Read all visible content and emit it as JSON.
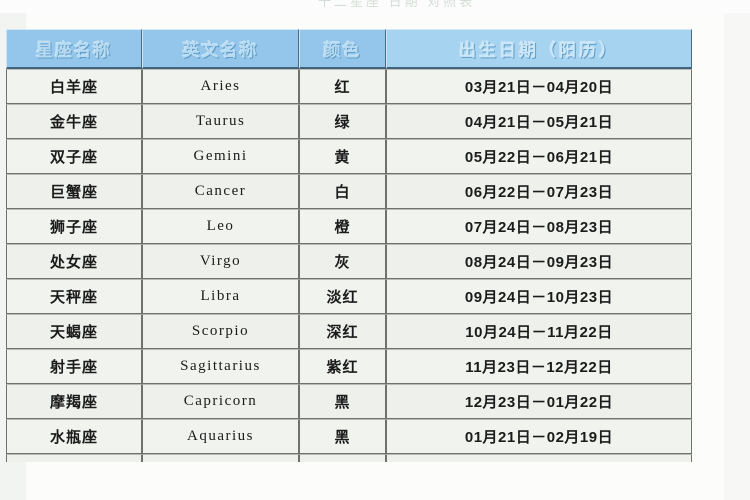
{
  "page": {
    "top_clipped_text": "十二星座 日期 对照表"
  },
  "table": {
    "title": "十二星座日期对照表",
    "headers": {
      "name": "星座名称",
      "english": "英文名称",
      "color": "颜色",
      "date": "出生日期（阳历）"
    },
    "colors": {
      "header_blue": "#93c6ea",
      "header_date_blue": "#a6d3f0",
      "header_text": "#b7dbf2",
      "cell_bg": "#f0f2ee",
      "grid_line": "#6f716c",
      "text": "#1b1b1b"
    },
    "rows": [
      {
        "name": "白羊座",
        "english": "Aries",
        "color": "红",
        "date": "03月21日－04月20日"
      },
      {
        "name": "金牛座",
        "english": "Taurus",
        "color": "绿",
        "date": "04月21日－05月21日"
      },
      {
        "name": "双子座",
        "english": "Gemini",
        "color": "黄",
        "date": "05月22日－06月21日"
      },
      {
        "name": "巨蟹座",
        "english": "Cancer",
        "color": "白",
        "date": "06月22日－07月23日"
      },
      {
        "name": "狮子座",
        "english": "Leo",
        "color": "橙",
        "date": "07月24日－08月23日"
      },
      {
        "name": "处女座",
        "english": "Virgo",
        "color": "灰",
        "date": "08月24日－09月23日"
      },
      {
        "name": "天秤座",
        "english": "Libra",
        "color": "淡红",
        "date": "09月24日－10月23日"
      },
      {
        "name": "天蝎座",
        "english": "Scorpio",
        "color": "深红",
        "date": "10月24日－11月22日"
      },
      {
        "name": "射手座",
        "english": "Sagittarius",
        "color": "紫红",
        "date": "11月23日－12月22日"
      },
      {
        "name": "摩羯座",
        "english": "Capricorn",
        "color": "黑",
        "date": "12月23日－01月22日"
      },
      {
        "name": "水瓶座",
        "english": "Aquarius",
        "color": "黑",
        "date": "01月21日－02月19日"
      }
    ]
  }
}
